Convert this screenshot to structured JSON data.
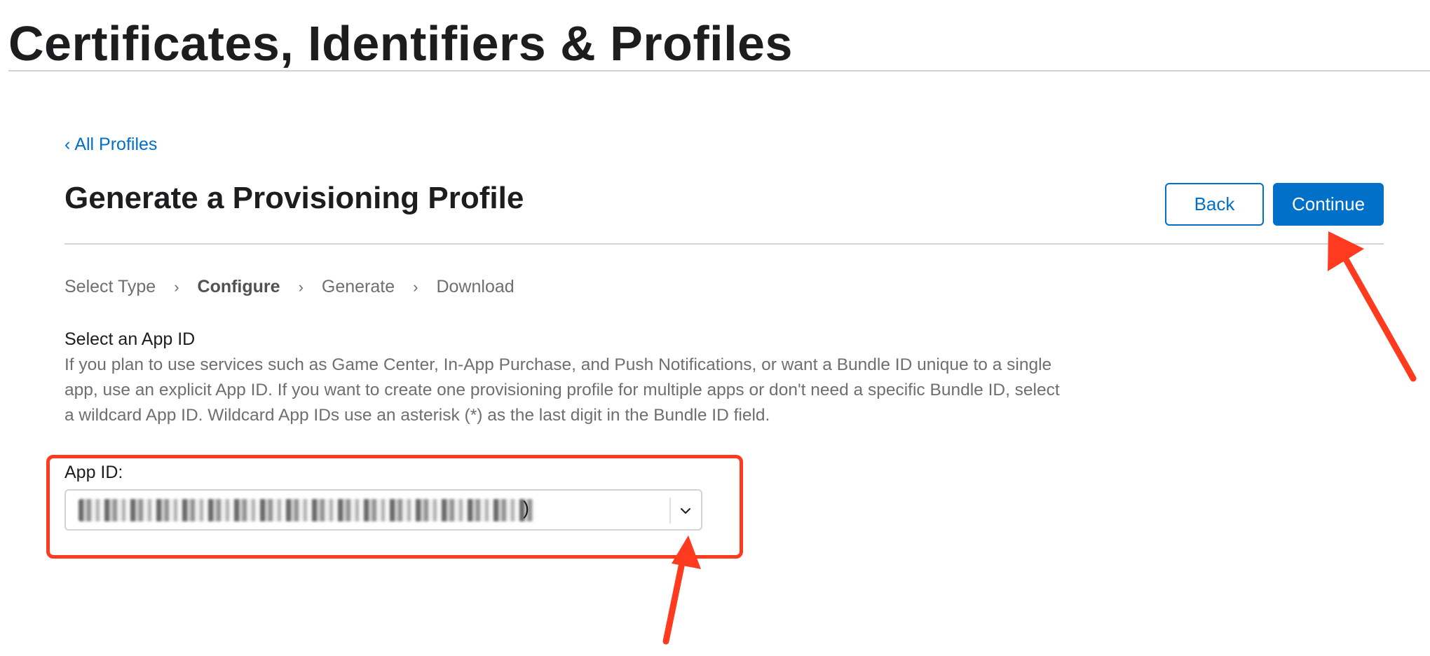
{
  "header": {
    "title": "Certificates, Identifiers & Profiles"
  },
  "nav": {
    "back_link": "All Profiles"
  },
  "section": {
    "title": "Generate a Provisioning Profile",
    "back_button": "Back",
    "continue_button": "Continue"
  },
  "steps": [
    {
      "label": "Select Type",
      "active": false
    },
    {
      "label": "Configure",
      "active": true
    },
    {
      "label": "Generate",
      "active": false
    },
    {
      "label": "Download",
      "active": false
    }
  ],
  "form": {
    "heading": "Select an App ID",
    "description": "If you plan to use services such as Game Center, In-App Purchase, and Push Notifications, or want a Bundle ID unique to a single app, use an explicit App ID. If you want to create one provisioning profile for multiple apps or don't need a specific Bundle ID, select a wildcard App ID. Wildcard App IDs use an asterisk (*) as the last digit in the Bundle ID field.",
    "app_id_label": "App ID:",
    "app_id_value_suffix": ")",
    "app_id_value_redacted": true
  },
  "annotations": {
    "color": "#ff3b1f",
    "arrows": [
      "arrow-to-continue",
      "arrow-to-dropdown"
    ]
  },
  "colors": {
    "link": "#0070c9",
    "primary_button": "#0070c9",
    "divider": "#d2d2d7",
    "muted_text": "#6e6e73"
  }
}
